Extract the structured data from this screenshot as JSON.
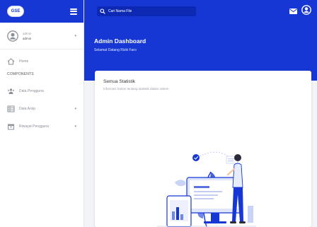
{
  "brand": {
    "logo_text": "GSE"
  },
  "user": {
    "name": "admin",
    "role": "admin"
  },
  "sidebar": {
    "home_label": "Home",
    "section_label": "COMPONENTS",
    "items": [
      {
        "label": "Data Pengguna"
      },
      {
        "label": "Data Arsip"
      },
      {
        "label": "Riwayat Pengguna"
      }
    ]
  },
  "search": {
    "placeholder": "Cari Nama File"
  },
  "page": {
    "title": "Admin Dashboard",
    "subtitle": "Selamat Datang Rizki Faro"
  },
  "card": {
    "title": "Semua Statistik",
    "description": "Informasi harian tentang statistik dalam sistem"
  },
  "colors": {
    "primary": "#1637d4",
    "primary_dark": "#0d29b4",
    "background": "#f2f4f7"
  }
}
